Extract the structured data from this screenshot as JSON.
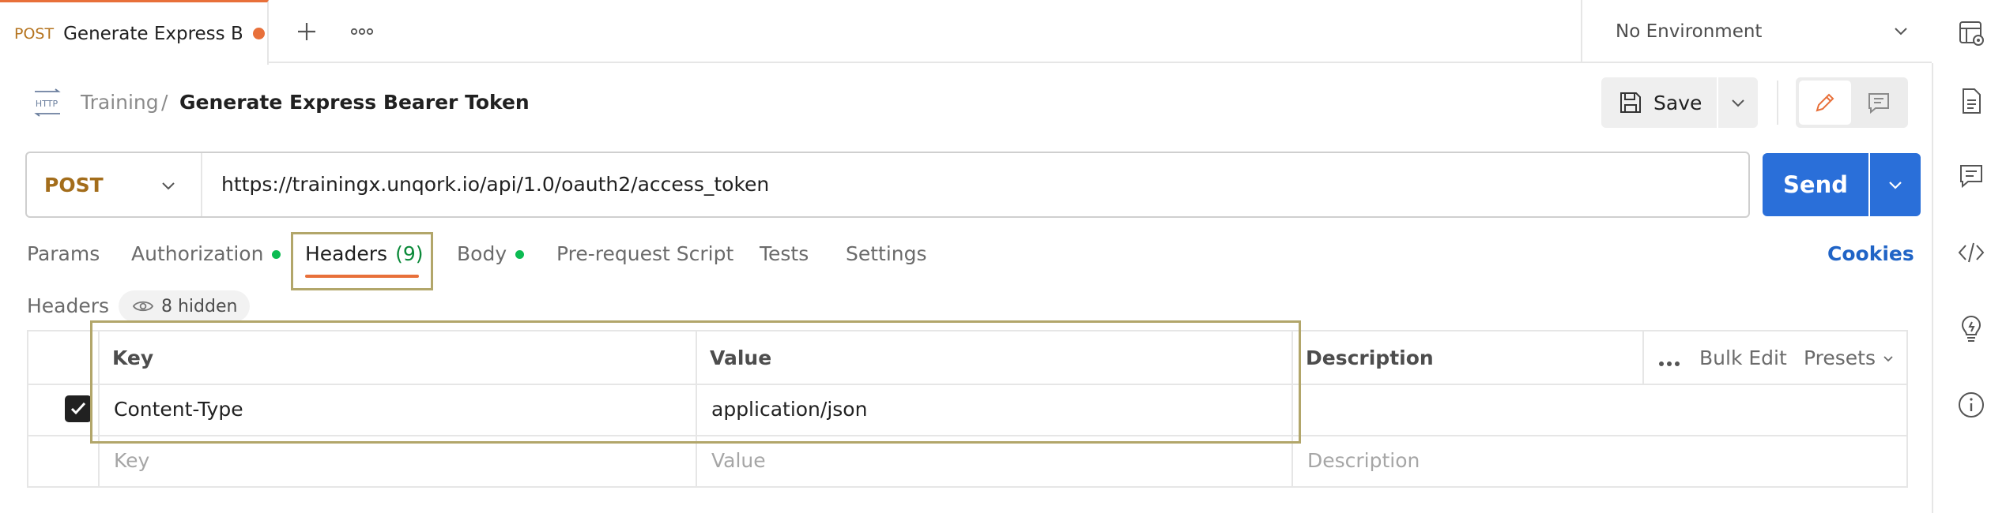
{
  "tab": {
    "method": "POST",
    "title": "Generate Express Bearer Token",
    "unsaved": true
  },
  "environment": {
    "label": "No Environment"
  },
  "breadcrumb": {
    "icon_label": "HTTP",
    "parent": "Training",
    "separator": "/",
    "current": "Generate Express Bearer Token"
  },
  "toolbar": {
    "save_label": "Save"
  },
  "request": {
    "method": "POST",
    "url": "https://trainingx.unqork.io/api/1.0/oauth2/access_token",
    "send_label": "Send"
  },
  "request_tabs": [
    {
      "label": "Params",
      "indicator": false
    },
    {
      "label": "Authorization",
      "indicator": true
    },
    {
      "label": "Headers",
      "count": "(9)",
      "active": true
    },
    {
      "label": "Body",
      "indicator": true
    },
    {
      "label": "Pre-request Script",
      "indicator": false
    },
    {
      "label": "Tests",
      "indicator": false
    },
    {
      "label": "Settings",
      "indicator": false
    }
  ],
  "cookies_label": "Cookies",
  "headers_section": {
    "title": "Headers",
    "hidden_label": "8 hidden"
  },
  "table": {
    "columns": [
      "Key",
      "Value",
      "Description"
    ],
    "bulk_edit": "Bulk Edit",
    "presets": "Presets",
    "rows": [
      {
        "checked": true,
        "key": "Content-Type",
        "value": "application/json",
        "description": ""
      }
    ],
    "placeholders": {
      "key": "Key",
      "value": "Value",
      "description": "Description"
    }
  },
  "colors": {
    "accent": "#e8703a",
    "send": "#2a6fd9",
    "method": "#a36d1b",
    "highlight": "#b2a66a",
    "indicator": "#0cbb52"
  }
}
